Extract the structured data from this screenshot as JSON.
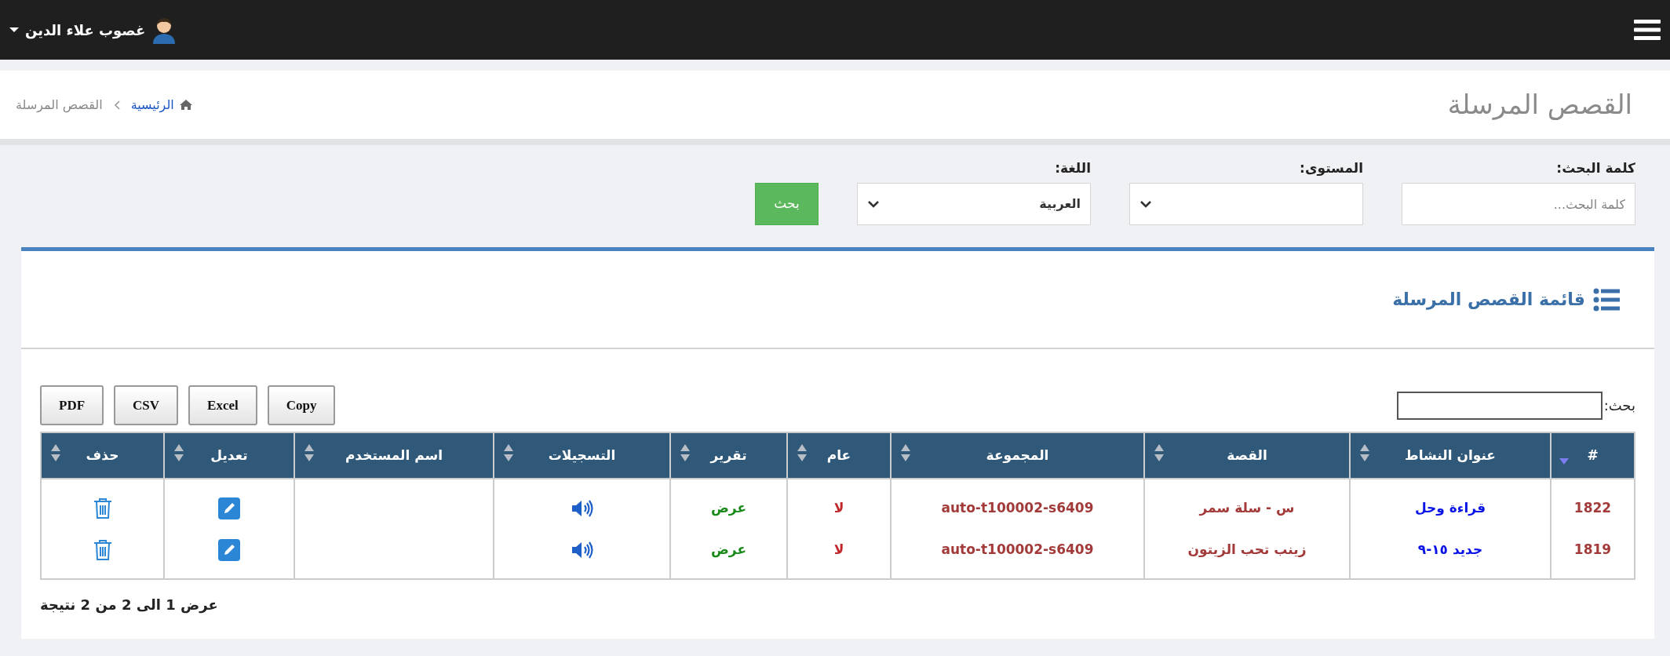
{
  "top_bar": {
    "user_name": "غصوب علاء الدين"
  },
  "page_header": {
    "title": "القصص المرسلة",
    "breadcrumb": [
      {
        "label": "الرئيسية",
        "kind": "home"
      },
      {
        "label": "القصص المرسلة",
        "kind": "current"
      }
    ]
  },
  "filters": {
    "fields": [
      {
        "label": "كلمة البحث:",
        "kind": "text",
        "placeholder": "كلمة البحث..."
      },
      {
        "label": "المستوى:",
        "kind": "select"
      },
      {
        "label": "اللغة:",
        "kind": "select",
        "value": "العربية"
      }
    ],
    "submit": "بحث"
  },
  "panel": {
    "title": "قائمة القصص المرسلة",
    "export_buttons": [
      "Copy",
      "Excel",
      "CSV",
      "PDF"
    ],
    "search_label": "بحث:",
    "table": {
      "columns": [
        {
          "label": "#",
          "sorted": true
        },
        {
          "label": "عنوان النشاط",
          "sorted": false
        },
        {
          "label": "القصة",
          "sorted": false
        },
        {
          "label": "المجموعة",
          "sorted": false
        },
        {
          "label": "عام",
          "sorted": false
        },
        {
          "label": "تقرير",
          "sorted": false
        },
        {
          "label": "التسجيلات",
          "sorted": false
        },
        {
          "label": "اسم المستخدم",
          "sorted": false
        },
        {
          "label": "تعديل",
          "sorted": false
        },
        {
          "label": "حذف",
          "sorted": false
        }
      ],
      "rows": [
        {
          "id": "1822",
          "activity": "قراءة وحل",
          "story": "س - سلة سمر",
          "group": "auto-t100002-s6409",
          "public": "لا",
          "report": "عرض"
        },
        {
          "id": "1819",
          "activity": "جديد ١٥-٩",
          "story": "زينب تحب الزيتون",
          "group": "auto-t100002-s6409",
          "public": "لا",
          "report": "عرض"
        }
      ]
    },
    "info": "عرض 1 الى 2 من 2 نتيجة"
  }
}
